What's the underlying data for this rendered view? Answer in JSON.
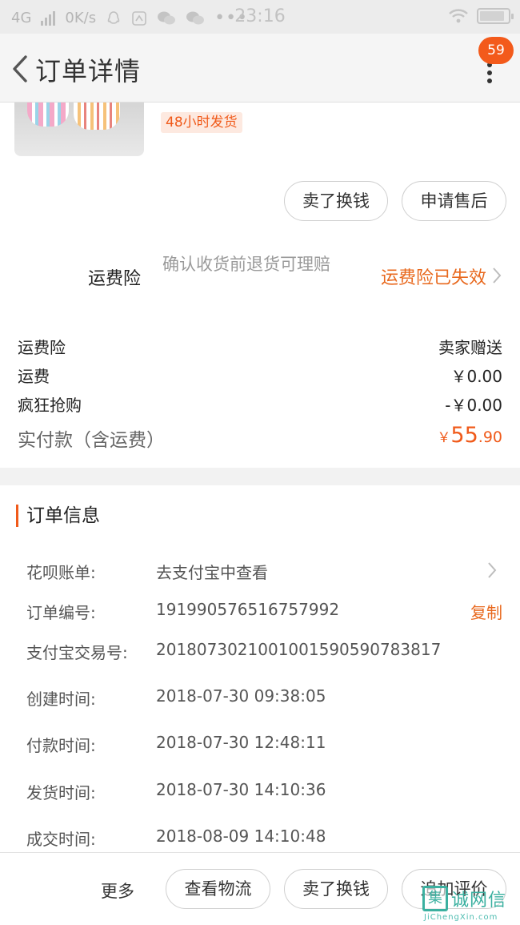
{
  "status_bar": {
    "network": "4G",
    "speed": "0K/s",
    "time": "23:16",
    "icons": [
      "signal-icon",
      "qq-icon",
      "notification-icon",
      "wechat-icon",
      "wechat-icon",
      "more-dots-icon",
      "wifi-icon",
      "battery-icon"
    ]
  },
  "nav": {
    "title": "订单详情",
    "badge_count": "59"
  },
  "product": {
    "ship_tag": "48小时发货"
  },
  "item_actions": {
    "sell_label": "卖了换钱",
    "after_sale_label": "申请售后"
  },
  "insurance": {
    "label": "运费险",
    "description": "确认收货前退货可理赔",
    "status": "运费险已失效"
  },
  "fees": [
    {
      "label": "运费险",
      "value": "卖家赠送"
    },
    {
      "label": "运费",
      "value": "￥0.00"
    },
    {
      "label": "疯狂抢购",
      "value": "-￥0.00"
    }
  ],
  "paid": {
    "label": "实付款（含运费）",
    "currency": "￥",
    "integer": "55",
    "decimal": ".90"
  },
  "order_info": {
    "title": "订单信息",
    "rows": [
      {
        "key": "花呗账单:",
        "value": "去支付宝中查看"
      },
      {
        "key": "订单编号:",
        "value": "191990576516757992"
      },
      {
        "key": "支付宝交易号:",
        "value": "2018073021001001590590783817"
      },
      {
        "key": "创建时间:",
        "value": "2018-07-30 09:38:05"
      },
      {
        "key": "付款时间:",
        "value": "2018-07-30 12:48:11"
      },
      {
        "key": "发货时间:",
        "value": "2018-07-30 14:10:36"
      },
      {
        "key": "成交时间:",
        "value": "2018-08-09 14:10:48"
      }
    ],
    "copy_label": "复制"
  },
  "bottom_bar": {
    "more_label": "更多",
    "logistics_label": "查看物流",
    "sell_label": "卖了换钱",
    "review_label": "追加评价"
  },
  "watermark": {
    "mark": "集",
    "text": "诚网信",
    "sub": "JiChengXin.com"
  },
  "colors": {
    "accent": "#f05a1a",
    "badge": "#f35a1b",
    "watermark": "#3bb0a0"
  }
}
